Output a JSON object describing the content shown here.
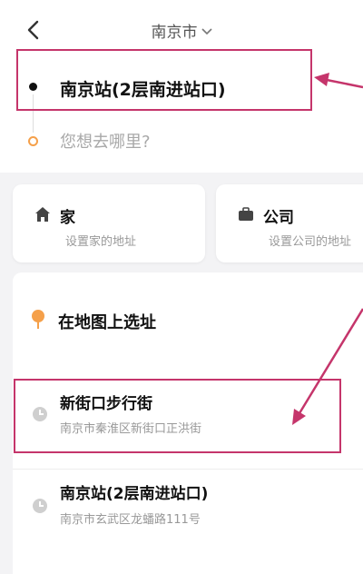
{
  "header": {
    "city": "南京市",
    "back_icon": "chevron-left-icon",
    "city_caret_icon": "chevron-down-icon"
  },
  "route": {
    "origin": "南京站(2层南进站口)",
    "destination_placeholder": "您想去哪里?",
    "destination_value": ""
  },
  "shortcuts": {
    "home": {
      "title": "家",
      "subtitle": "设置家的地址",
      "icon": "home-icon"
    },
    "work": {
      "title": "公司",
      "subtitle": "设置公司的地址",
      "icon": "briefcase-icon"
    }
  },
  "map_pick": {
    "label": "在地图上选址",
    "icon": "map-pin-icon"
  },
  "history": [
    {
      "title": "新街口步行街",
      "subtitle": "南京市秦淮区新街口正洪街",
      "icon": "clock-icon"
    },
    {
      "title": "南京站(2层南进站口)",
      "subtitle": "南京市玄武区龙蟠路111号",
      "icon": "clock-icon"
    }
  ],
  "colors": {
    "annotation": "#c5356b",
    "pin": "#f5a04a",
    "destination_ring": "#f5a04a"
  }
}
